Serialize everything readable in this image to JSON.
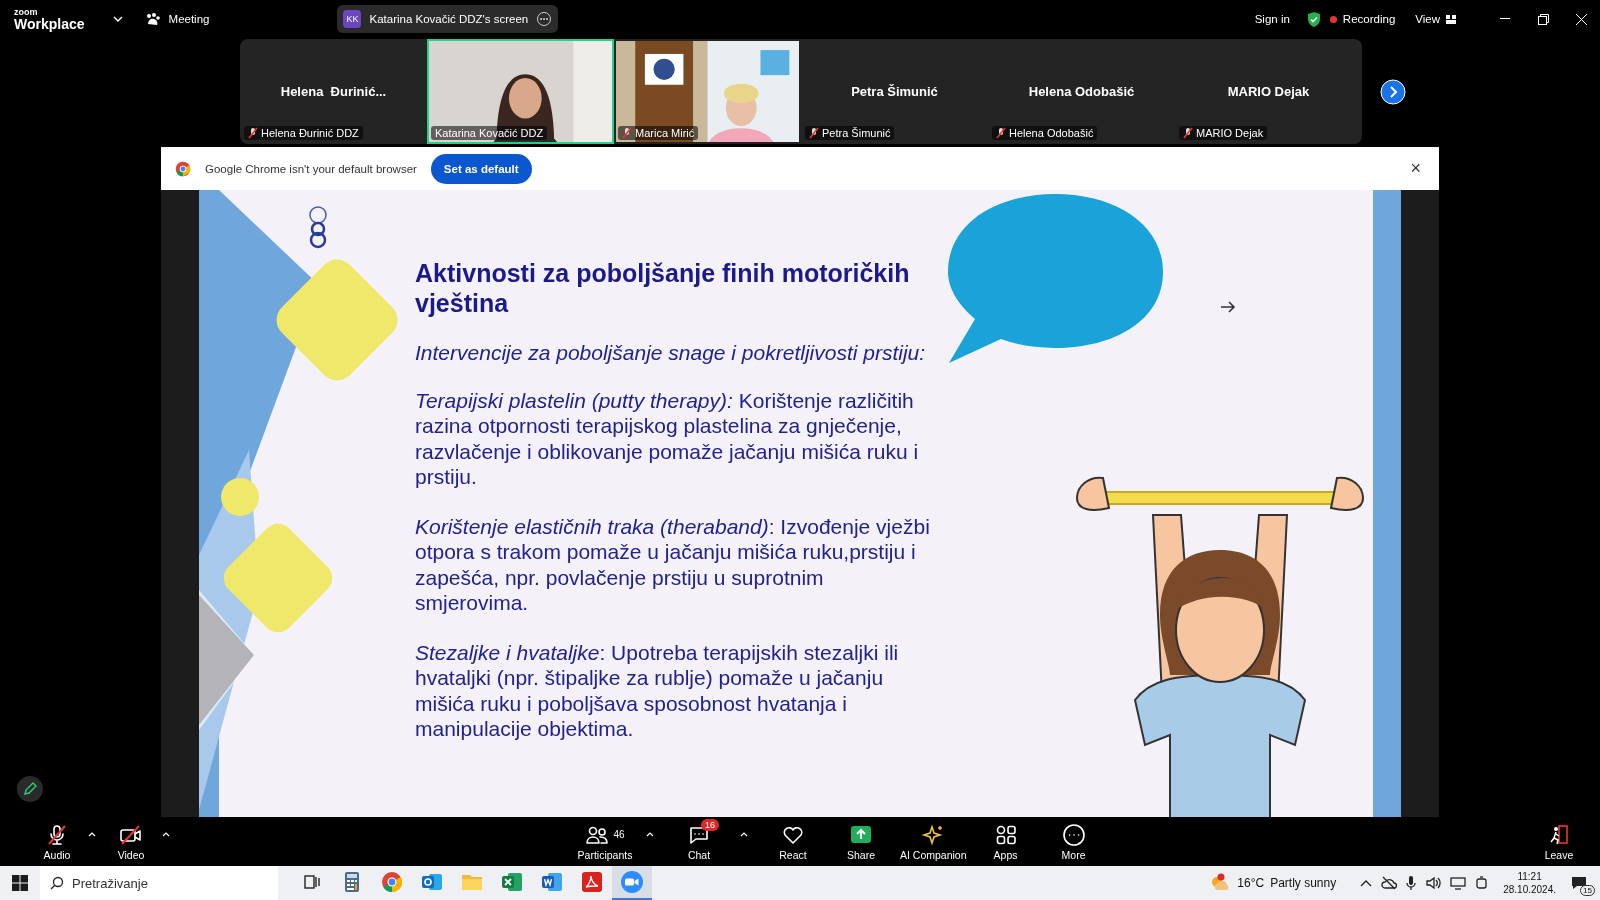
{
  "top_bar": {
    "brand_top": "zoom",
    "brand_bottom": "Workplace",
    "meeting": "Meeting",
    "share_indicator": {
      "initials": "KK",
      "label": "Katarina Kovačić DDZ's screen"
    },
    "sign_in": "Sign in",
    "recording": "Recording",
    "view": "View"
  },
  "participants_strip": [
    {
      "kind": "name",
      "display": "Helena  Đurinić...",
      "label": "Helena Đurinić DDZ",
      "muted": true,
      "active": false
    },
    {
      "kind": "video",
      "label": "Katarina Kovačić DDZ",
      "muted": false,
      "active": true
    },
    {
      "kind": "video",
      "label": "Marica Mirić",
      "muted": true,
      "active": false
    },
    {
      "kind": "name",
      "display": "Petra Šimunić",
      "label": "Petra Šimunić",
      "muted": true,
      "active": false
    },
    {
      "kind": "name",
      "display": "Helena Odobašić",
      "label": "Helena Odobašić",
      "muted": true,
      "active": false
    },
    {
      "kind": "name",
      "display": "MARIO Dejak",
      "label": "MARIO Dejak",
      "muted": true,
      "active": false
    }
  ],
  "browser_banner": {
    "message": "Google Chrome isn't your default browser",
    "button": "Set as default",
    "close": "×"
  },
  "slide": {
    "title": "Aktivnosti za poboljšanje finih motoričkih vještina",
    "subtitle": "Intervencije za poboljšanje snage i pokretljivosti prstiju:",
    "paragraphs": [
      "*Terapijski plastelin (putty therapy):* Korištenje različitih razina otpornosti terapijskog plastelina za gnječenje, razvlačenje i oblikovanje pomaže jačanju mišića ruku i prstiju.",
      "*Korištenje elastičnih traka (theraband)*: Izvođenje vježbi otpora s trakom pomaže u jačanju mišića ruku,prstiju i zapešća, npr. povlačenje prstiju u suprotnim smjerovima.",
      "*Stezaljke i hvataljke*: Upotreba terapijskih stezaljki ili hvataljki (npr. štipaljke za rublje) pomaže u jačanju mišića ruku i poboljšava sposobnost hvatanja i manipulacije objektima."
    ]
  },
  "toolbar": {
    "left": [
      {
        "kind": "audio",
        "label": "Audio",
        "muted": true
      },
      {
        "kind": "video",
        "label": "Video",
        "muted": true
      }
    ],
    "center": [
      {
        "kind": "participants",
        "label": "Participants",
        "count": "46"
      },
      {
        "kind": "chat",
        "label": "Chat",
        "badge": "16"
      },
      {
        "kind": "react",
        "label": "React"
      },
      {
        "kind": "share",
        "label": "Share"
      },
      {
        "kind": "ai",
        "label": "AI Companion"
      },
      {
        "kind": "apps",
        "label": "Apps"
      },
      {
        "kind": "more",
        "label": "More"
      }
    ],
    "leave": "Leave"
  },
  "taskbar": {
    "search_placeholder": "Pretraživanje",
    "apps": [
      {
        "kind": "taskview",
        "selected": false
      },
      {
        "kind": "calculator",
        "selected": false
      },
      {
        "kind": "chrome",
        "selected": false
      },
      {
        "kind": "outlook",
        "selected": false
      },
      {
        "kind": "files",
        "selected": false
      },
      {
        "kind": "excel",
        "selected": false
      },
      {
        "kind": "word",
        "selected": false
      },
      {
        "kind": "acrobat",
        "selected": false
      },
      {
        "kind": "zoom",
        "selected": true
      }
    ],
    "weather": {
      "temperature": "16°C",
      "condition": "Partly sunny"
    },
    "time": "11:21",
    "date": "28.10.2024.",
    "notifications": "15"
  }
}
